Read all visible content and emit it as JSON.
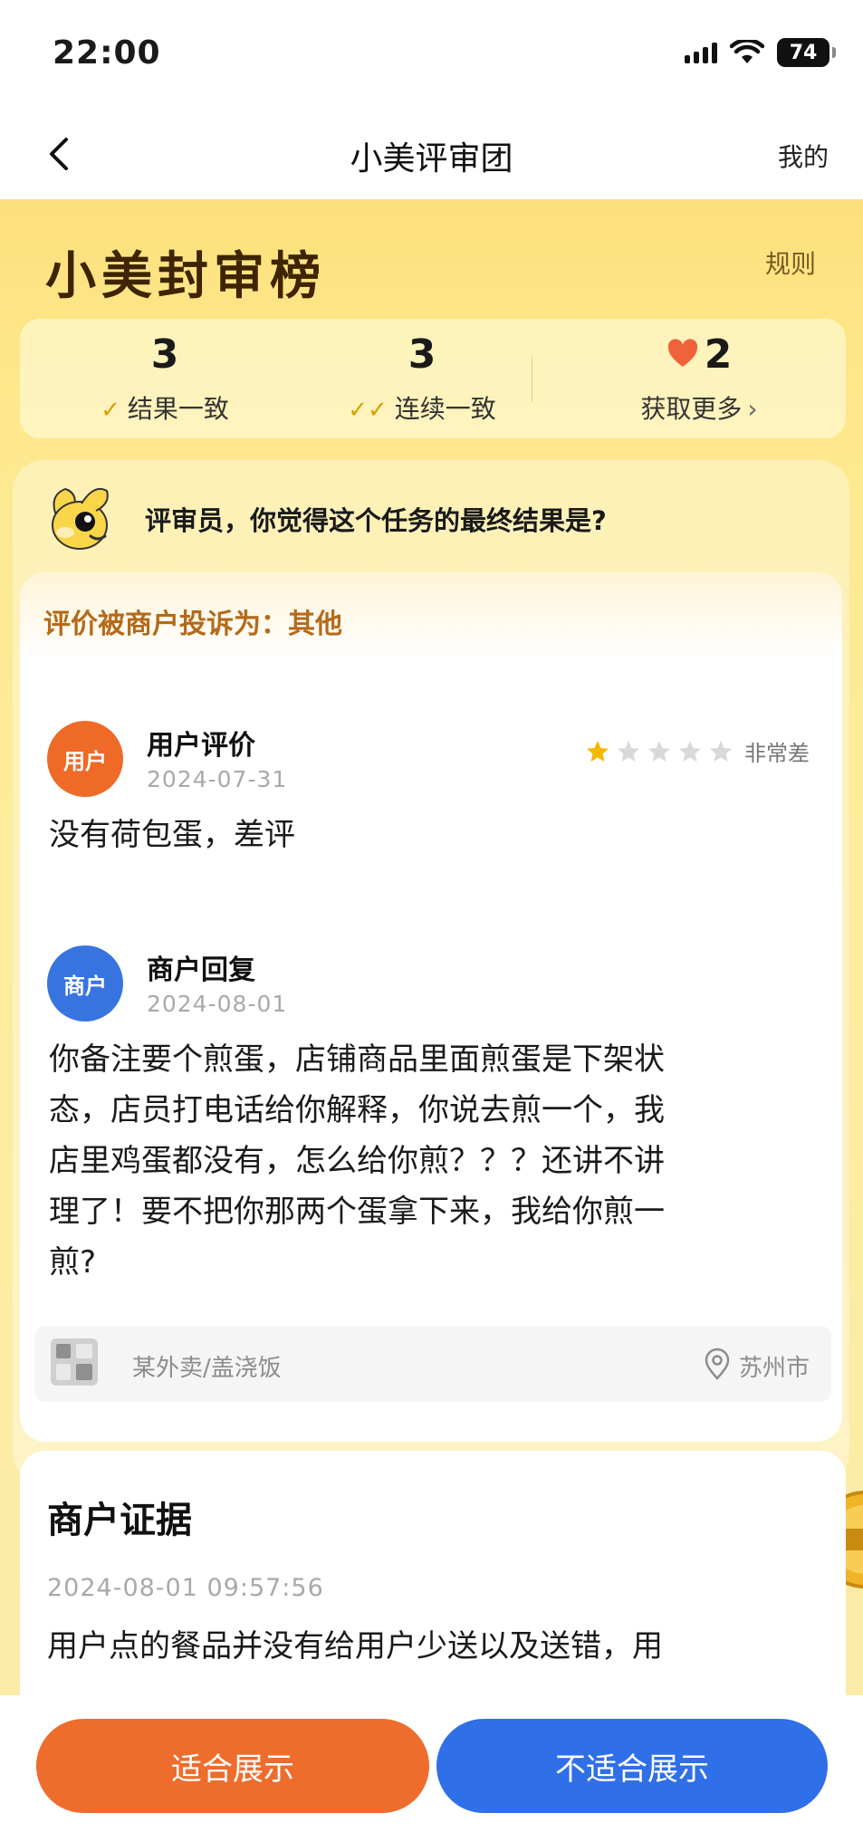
{
  "status_bar": {
    "time": "22:00",
    "battery": "74"
  },
  "nav": {
    "title": "小美评审团",
    "mine": "我的"
  },
  "banner": {
    "title": "小美封审榜",
    "rules": "规则"
  },
  "stats": [
    {
      "value": "3",
      "label": "结果一致"
    },
    {
      "value": "3",
      "label": "连续一致"
    },
    {
      "value": "2",
      "label": "获取更多"
    }
  ],
  "question": "评审员，你觉得这个任务的最终结果是?",
  "complaint": "评价被商户投诉为：其他",
  "user_review": {
    "avatar_label": "用户",
    "title": "用户评价",
    "date": "2024-07-31",
    "rating": 1,
    "rating_max": 5,
    "rating_text": "非常差",
    "content": "没有荷包蛋，差评"
  },
  "merchant_reply": {
    "avatar_label": "商户",
    "title": "商户回复",
    "date": "2024-08-01",
    "lines": [
      "你备注要个煎蛋，店铺商品里面煎蛋是下架状",
      "态，店员打电话给你解释，你说去煎一个，我",
      "店里鸡蛋都没有，怎么给你煎？？？还讲不讲",
      "理了！要不把你那两个蛋拿下来，我给你煎一",
      "煎?"
    ]
  },
  "store": {
    "name": "某外卖/盖浇饭",
    "city": "苏州市"
  },
  "evidence": {
    "title": "商户证据",
    "time": "2024-08-01 09:57:56",
    "text": "用户点的餐品并没有给用户少送以及送错，用"
  },
  "actions": {
    "show": "适合展示",
    "hide": "不适合展示"
  },
  "colors": {
    "accent_orange": "#ee6c2c",
    "accent_blue": "#2f6fe8",
    "banner_yellow": "#fde07c",
    "star_gold": "#f5b800"
  }
}
